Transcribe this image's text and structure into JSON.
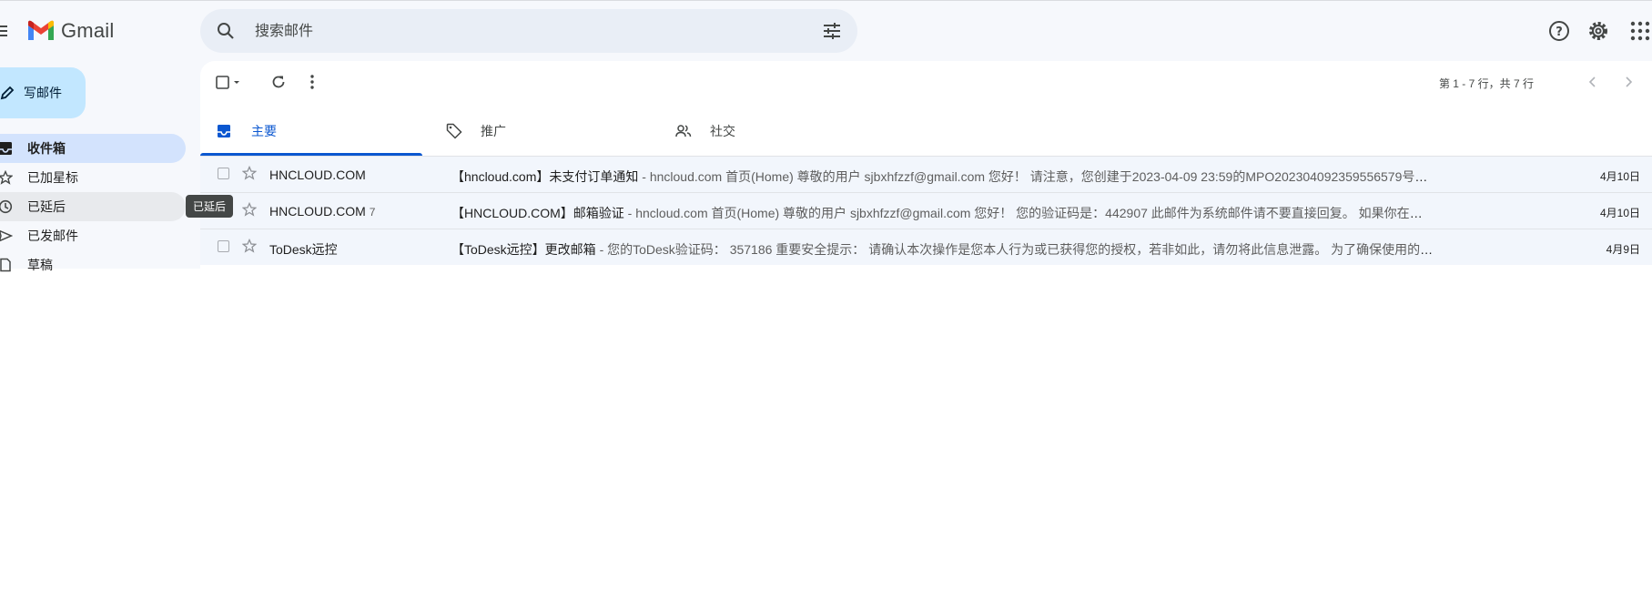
{
  "header": {
    "logo_text": "Gmail",
    "search_placeholder": "搜索邮件",
    "icons": [
      "menu-icon",
      "gmail-logo",
      "search-icon",
      "tune-icon",
      "help-icon",
      "settings-icon",
      "apps-icon"
    ]
  },
  "compose": {
    "label": "写邮件"
  },
  "nav": {
    "items": [
      {
        "label": "收件箱",
        "icon": "inbox-icon",
        "state": "active"
      },
      {
        "label": "已加星标",
        "icon": "star-icon",
        "state": ""
      },
      {
        "label": "已延后",
        "icon": "clock-icon",
        "state": "hover"
      },
      {
        "label": "已发邮件",
        "icon": "send-icon",
        "state": ""
      },
      {
        "label": "草稿",
        "icon": "draft-icon",
        "state": ""
      }
    ],
    "tooltip": "已延后"
  },
  "toolbar": {
    "pager": "第 1 - 7 行，共 7 行"
  },
  "tabs": [
    {
      "label": "主要",
      "icon": "inbox-icon",
      "active": true
    },
    {
      "label": "推广",
      "icon": "tag-icon",
      "active": false
    },
    {
      "label": "社交",
      "icon": "people-icon",
      "active": false
    }
  ],
  "emails": [
    {
      "sender": "HNCLOUD.COM",
      "count": "",
      "subject": "【hncloud.com】未支付订单通知",
      "snippet": " - hncloud.com 首页(Home) 尊敬的用户 sjbxhfzzf@gmail.com 您好！ 请注意，您创建于2023-04-09 23:59的MPO20230409235955657​9号账单处于未支付状...",
      "date": "4月10日"
    },
    {
      "sender": "HNCLOUD.COM",
      "count": "7",
      "subject": "【HNCLOUD.COM】邮箱验证",
      "snippet": " - hncloud.com 首页(Home) 尊敬的用户 sjbxhfzzf@gmail.com 您好！ 您的验证码是：442907 此邮件为系统邮件请不要直接回复。 如果你在使用过程中遇到问题，...",
      "date": "4月10日"
    },
    {
      "sender": "ToDesk远控",
      "count": "",
      "subject": "【ToDesk远控】更改邮箱",
      "snippet": " - 您的ToDesk验证码： 357186 重要安全提示： 请确认本次操作是您本人行为或已获得您的授权，若非如此，请勿将此信息泄露。 为了确保使用的安全性、隐私性，请...",
      "date": "4月9日"
    }
  ]
}
